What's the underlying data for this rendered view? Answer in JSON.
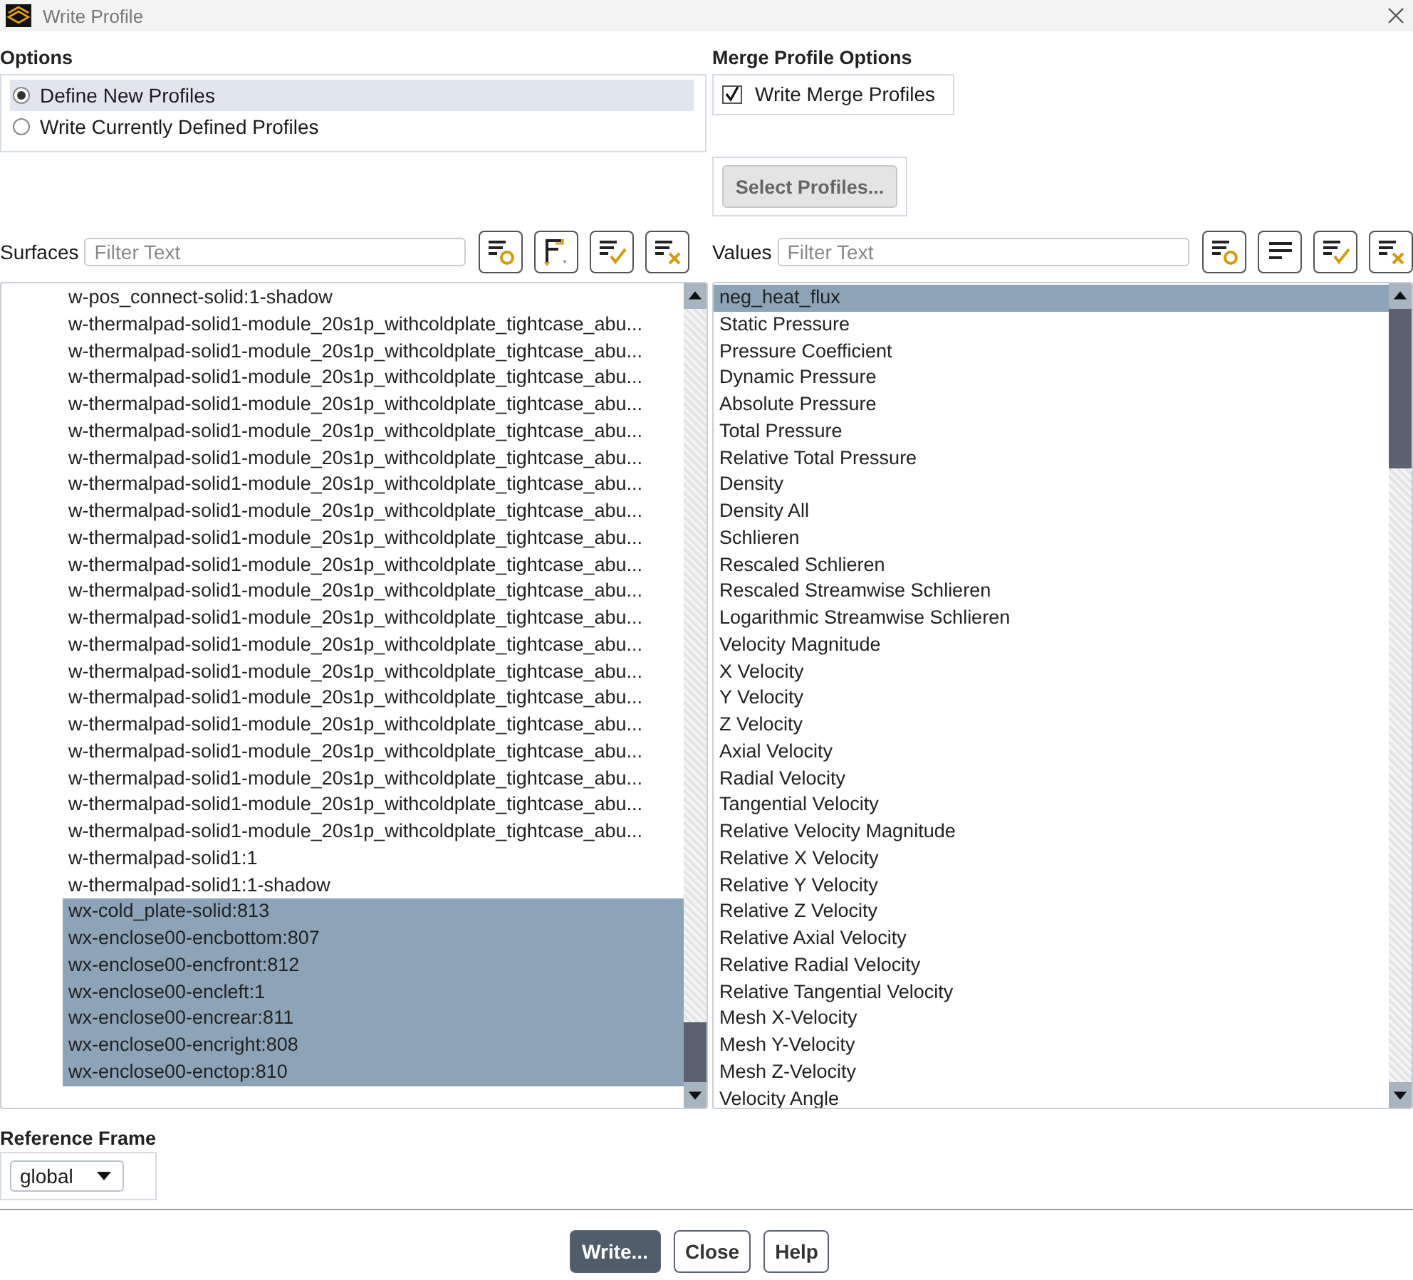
{
  "window": {
    "title": "Write Profile"
  },
  "options": {
    "label": "Options",
    "items": [
      {
        "label": "Define New Profiles",
        "selected": true
      },
      {
        "label": "Write Currently Defined Profiles",
        "selected": false
      }
    ]
  },
  "merge": {
    "label": "Merge Profile Options",
    "checkbox": {
      "label": "Write Merge Profiles",
      "checked": true
    },
    "select_button": "Select Profiles..."
  },
  "surfaces": {
    "label": "Surfaces",
    "placeholder": "Filter Text",
    "items": [
      {
        "text": "w-pos_connect-solid:1-shadow",
        "selected": false
      },
      {
        "text": "w-thermalpad-solid1-module_20s1p_withcoldplate_tightcase_abu...",
        "selected": false
      },
      {
        "text": "w-thermalpad-solid1-module_20s1p_withcoldplate_tightcase_abu...",
        "selected": false
      },
      {
        "text": "w-thermalpad-solid1-module_20s1p_withcoldplate_tightcase_abu...",
        "selected": false
      },
      {
        "text": "w-thermalpad-solid1-module_20s1p_withcoldplate_tightcase_abu...",
        "selected": false
      },
      {
        "text": "w-thermalpad-solid1-module_20s1p_withcoldplate_tightcase_abu...",
        "selected": false
      },
      {
        "text": "w-thermalpad-solid1-module_20s1p_withcoldplate_tightcase_abu...",
        "selected": false
      },
      {
        "text": "w-thermalpad-solid1-module_20s1p_withcoldplate_tightcase_abu...",
        "selected": false
      },
      {
        "text": "w-thermalpad-solid1-module_20s1p_withcoldplate_tightcase_abu...",
        "selected": false
      },
      {
        "text": "w-thermalpad-solid1-module_20s1p_withcoldplate_tightcase_abu...",
        "selected": false
      },
      {
        "text": "w-thermalpad-solid1-module_20s1p_withcoldplate_tightcase_abu...",
        "selected": false
      },
      {
        "text": "w-thermalpad-solid1-module_20s1p_withcoldplate_tightcase_abu...",
        "selected": false
      },
      {
        "text": "w-thermalpad-solid1-module_20s1p_withcoldplate_tightcase_abu...",
        "selected": false
      },
      {
        "text": "w-thermalpad-solid1-module_20s1p_withcoldplate_tightcase_abu...",
        "selected": false
      },
      {
        "text": "w-thermalpad-solid1-module_20s1p_withcoldplate_tightcase_abu...",
        "selected": false
      },
      {
        "text": "w-thermalpad-solid1-module_20s1p_withcoldplate_tightcase_abu...",
        "selected": false
      },
      {
        "text": "w-thermalpad-solid1-module_20s1p_withcoldplate_tightcase_abu...",
        "selected": false
      },
      {
        "text": "w-thermalpad-solid1-module_20s1p_withcoldplate_tightcase_abu...",
        "selected": false
      },
      {
        "text": "w-thermalpad-solid1-module_20s1p_withcoldplate_tightcase_abu...",
        "selected": false
      },
      {
        "text": "w-thermalpad-solid1-module_20s1p_withcoldplate_tightcase_abu...",
        "selected": false
      },
      {
        "text": "w-thermalpad-solid1-module_20s1p_withcoldplate_tightcase_abu...",
        "selected": false
      },
      {
        "text": "w-thermalpad-solid1:1",
        "selected": false
      },
      {
        "text": "w-thermalpad-solid1:1-shadow",
        "selected": false
      },
      {
        "text": "wx-cold_plate-solid:813",
        "selected": true
      },
      {
        "text": "wx-enclose00-encbottom:807",
        "selected": true
      },
      {
        "text": "wx-enclose00-encfront:812",
        "selected": true
      },
      {
        "text": "wx-enclose00-encleft:1",
        "selected": true
      },
      {
        "text": "wx-enclose00-encrear:811",
        "selected": true
      },
      {
        "text": "wx-enclose00-encright:808",
        "selected": true
      },
      {
        "text": "wx-enclose00-enctop:810",
        "selected": true
      }
    ]
  },
  "values": {
    "label": "Values",
    "placeholder": "Filter Text",
    "items": [
      {
        "text": "neg_heat_flux",
        "selected": true
      },
      {
        "text": "Static Pressure",
        "selected": false
      },
      {
        "text": "Pressure Coefficient",
        "selected": false
      },
      {
        "text": "Dynamic Pressure",
        "selected": false
      },
      {
        "text": "Absolute Pressure",
        "selected": false
      },
      {
        "text": "Total Pressure",
        "selected": false
      },
      {
        "text": "Relative Total Pressure",
        "selected": false
      },
      {
        "text": "Density",
        "selected": false
      },
      {
        "text": "Density All",
        "selected": false
      },
      {
        "text": "Schlieren",
        "selected": false
      },
      {
        "text": "Rescaled Schlieren",
        "selected": false
      },
      {
        "text": "Rescaled Streamwise Schlieren",
        "selected": false
      },
      {
        "text": "Logarithmic Streamwise Schlieren",
        "selected": false
      },
      {
        "text": "Velocity Magnitude",
        "selected": false
      },
      {
        "text": "X Velocity",
        "selected": false
      },
      {
        "text": "Y Velocity",
        "selected": false
      },
      {
        "text": "Z Velocity",
        "selected": false
      },
      {
        "text": "Axial Velocity",
        "selected": false
      },
      {
        "text": "Radial Velocity",
        "selected": false
      },
      {
        "text": "Tangential Velocity",
        "selected": false
      },
      {
        "text": "Relative Velocity Magnitude",
        "selected": false
      },
      {
        "text": "Relative X Velocity",
        "selected": false
      },
      {
        "text": "Relative Y Velocity",
        "selected": false
      },
      {
        "text": "Relative Z Velocity",
        "selected": false
      },
      {
        "text": "Relative Axial Velocity",
        "selected": false
      },
      {
        "text": "Relative Radial Velocity",
        "selected": false
      },
      {
        "text": "Relative Tangential Velocity",
        "selected": false
      },
      {
        "text": "Mesh X-Velocity",
        "selected": false
      },
      {
        "text": "Mesh Y-Velocity",
        "selected": false
      },
      {
        "text": "Mesh Z-Velocity",
        "selected": false
      },
      {
        "text": "Velocity Angle",
        "selected": false
      }
    ]
  },
  "reference_frame": {
    "label": "Reference Frame",
    "value": "global"
  },
  "buttons": [
    {
      "label": "Write...",
      "kind": "primary"
    },
    {
      "label": "Close",
      "kind": "normal"
    },
    {
      "label": "Help",
      "kind": "normal"
    }
  ]
}
